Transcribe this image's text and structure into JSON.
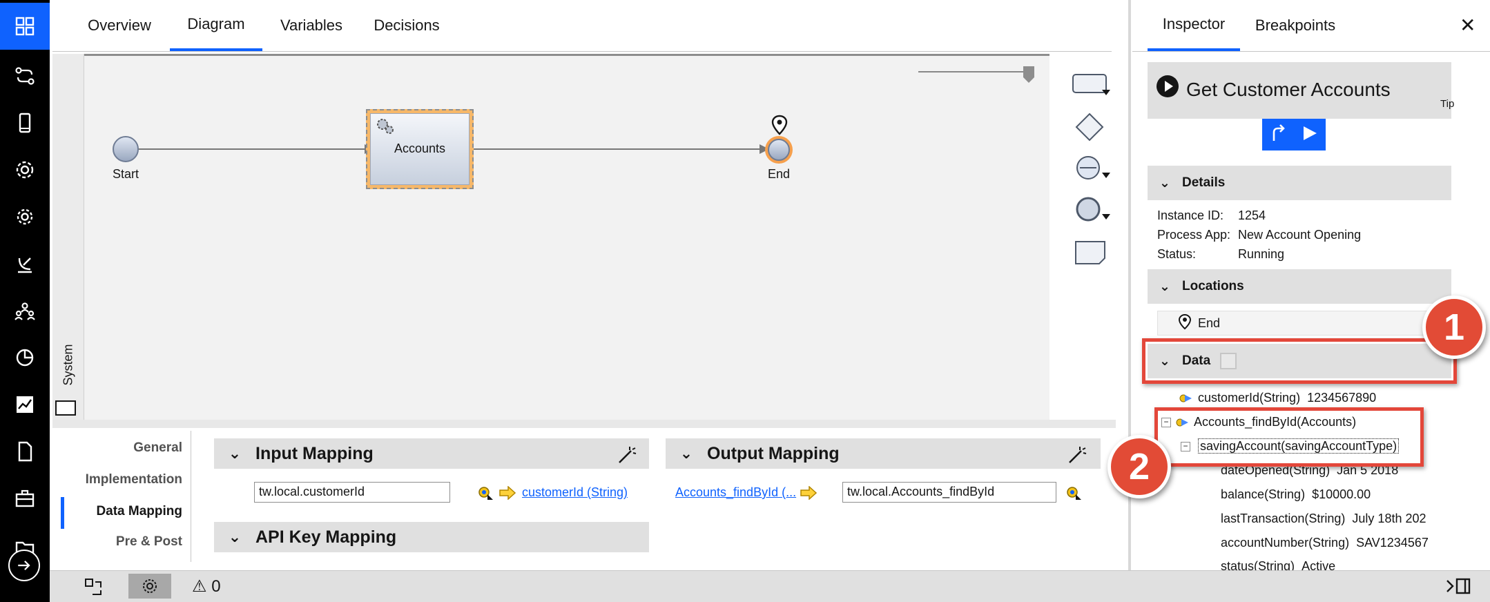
{
  "tabs": [
    {
      "label": "Overview"
    },
    {
      "label": "Diagram"
    },
    {
      "label": "Variables"
    },
    {
      "label": "Decisions"
    }
  ],
  "diagram": {
    "lane_label": "System",
    "nodes": {
      "start": "Start",
      "activity": "Accounts",
      "end": "End"
    }
  },
  "bottom_panel": {
    "side_tabs": [
      "General",
      "Implementation",
      "Data Mapping",
      "Pre & Post"
    ],
    "input_mapping": {
      "title": "Input Mapping",
      "field_value": "tw.local.customerId",
      "link": "customerId (String)"
    },
    "output_mapping": {
      "title": "Output Mapping",
      "link": "Accounts_findById (...",
      "field_value": "tw.local.Accounts_findById"
    },
    "api_key_mapping": {
      "title": "API Key Mapping"
    }
  },
  "inspector": {
    "tabs": [
      "Inspector",
      "Breakpoints"
    ],
    "close_label": "✕",
    "task_title": "Get Customer Accounts",
    "tip_label": "Tip",
    "details": {
      "title": "Details",
      "rows": [
        {
          "key": "Instance ID:",
          "value": "1254"
        },
        {
          "key": "Process App:",
          "value": "New Account Opening"
        },
        {
          "key": "Status:",
          "value": "Running"
        }
      ]
    },
    "locations": {
      "title": "Locations",
      "item": "End"
    },
    "data": {
      "title": "Data",
      "items": [
        {
          "label": "customerId(String)",
          "value": "1234567890"
        },
        {
          "label": "Accounts_findById(Accounts)",
          "value": ""
        },
        {
          "label": "savingAccount(savingAccountType)",
          "value": ""
        },
        {
          "label": "dateOpened(String)",
          "value": "Jan 5 2018"
        },
        {
          "label": "balance(String)",
          "value": "$10000.00"
        },
        {
          "label": "lastTransaction(String)",
          "value": "July 18th 202"
        },
        {
          "label": "accountNumber(String)",
          "value": "SAV1234567"
        },
        {
          "label": "status(String)",
          "value": "Active"
        }
      ]
    }
  },
  "callouts": [
    "1",
    "2"
  ],
  "status_bar": {
    "warning_count": "0"
  },
  "colors": {
    "accent": "#0f62fe",
    "callout": "#e24b36",
    "nav_bg": "#000000"
  }
}
